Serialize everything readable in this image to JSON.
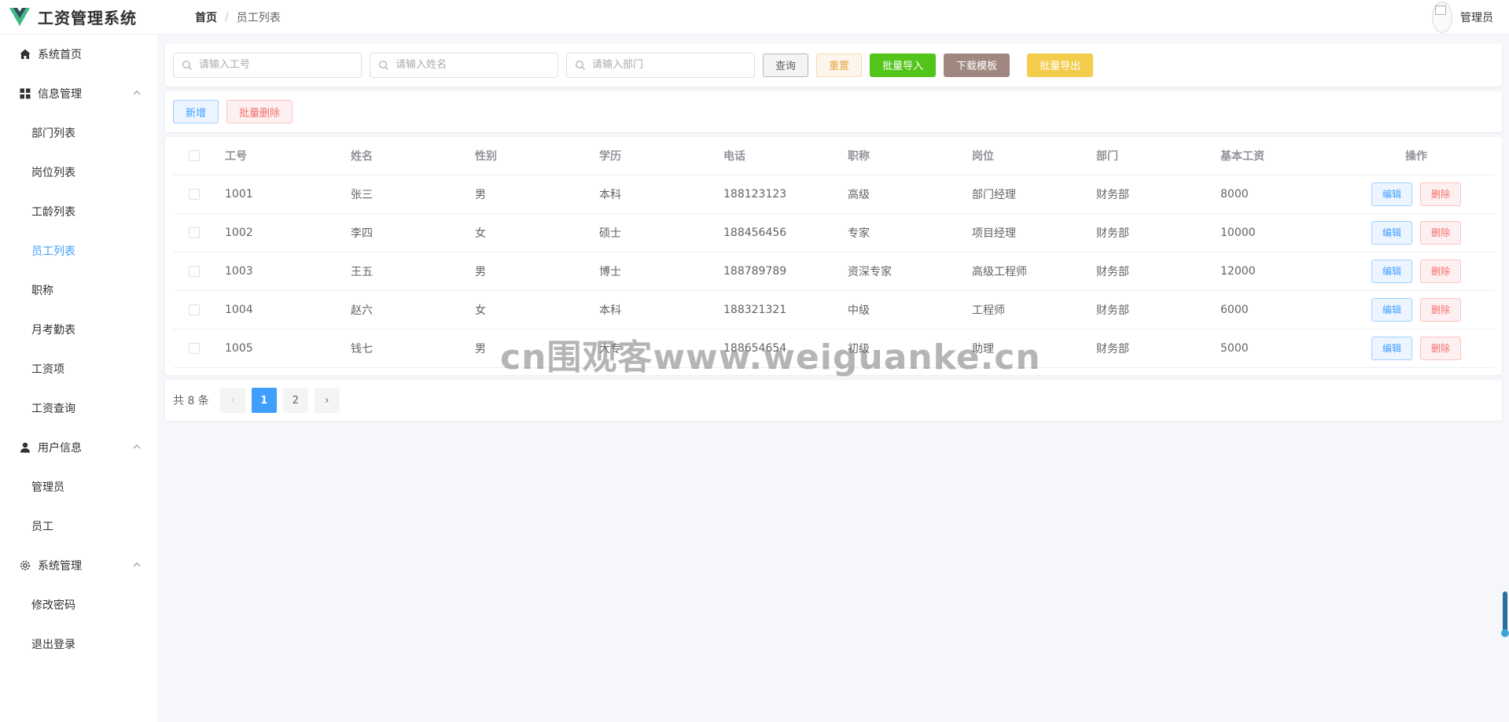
{
  "app": {
    "title": "工资管理系统"
  },
  "breadcrumb": {
    "home": "首页",
    "separator": "/",
    "current": "员工列表"
  },
  "user": {
    "name": "管理员"
  },
  "sidebar": {
    "home": "系统首页",
    "info_group": "信息管理",
    "info_items": [
      "部门列表",
      "岗位列表",
      "工龄列表",
      "员工列表",
      "职称",
      "月考勤表",
      "工资项",
      "工资查询"
    ],
    "user_group": "用户信息",
    "user_items": [
      "管理员",
      "员工"
    ],
    "system_group": "系统管理",
    "system_items": [
      "修改密码",
      "退出登录"
    ]
  },
  "search": {
    "id_placeholder": "请输入工号",
    "name_placeholder": "请输入姓名",
    "dept_placeholder": "请输入部门",
    "query": "查询",
    "reset": "重置",
    "batch_import": "批量导入",
    "download_template": "下载模板",
    "batch_export": "批量导出"
  },
  "toolbar": {
    "add": "新增",
    "batch_delete": "批量删除"
  },
  "table": {
    "headers": [
      "工号",
      "姓名",
      "性别",
      "学历",
      "电话",
      "职称",
      "岗位",
      "部门",
      "基本工资",
      "操作"
    ],
    "edit_label": "编辑",
    "delete_label": "删除",
    "rows": [
      {
        "id": "1001",
        "name": "张三",
        "gender": "男",
        "education": "本科",
        "phone": "188123123",
        "title": "高级",
        "post": "部门经理",
        "dept": "财务部",
        "salary": "8000"
      },
      {
        "id": "1002",
        "name": "李四",
        "gender": "女",
        "education": "硕士",
        "phone": "188456456",
        "title": "专家",
        "post": "项目经理",
        "dept": "财务部",
        "salary": "10000"
      },
      {
        "id": "1003",
        "name": "王五",
        "gender": "男",
        "education": "博士",
        "phone": "188789789",
        "title": "资深专家",
        "post": "高级工程师",
        "dept": "财务部",
        "salary": "12000"
      },
      {
        "id": "1004",
        "name": "赵六",
        "gender": "女",
        "education": "本科",
        "phone": "188321321",
        "title": "中级",
        "post": "工程师",
        "dept": "财务部",
        "salary": "6000"
      },
      {
        "id": "1005",
        "name": "钱七",
        "gender": "男",
        "education": "大专",
        "phone": "188654654",
        "title": "初级",
        "post": "助理",
        "dept": "财务部",
        "salary": "5000"
      }
    ]
  },
  "pagination": {
    "total": "共 8 条",
    "prev": "‹",
    "next": "›",
    "pages": [
      "1",
      "2"
    ],
    "current": "1"
  },
  "watermark": "cn围观客www.weiguanke.cn",
  "colors": {
    "primary": "#409eff",
    "success": "#52c41a",
    "warning": "#f3cc4c",
    "danger": "#f56c6c",
    "brand_green": "#41b883",
    "brand_dark": "#34495e"
  }
}
